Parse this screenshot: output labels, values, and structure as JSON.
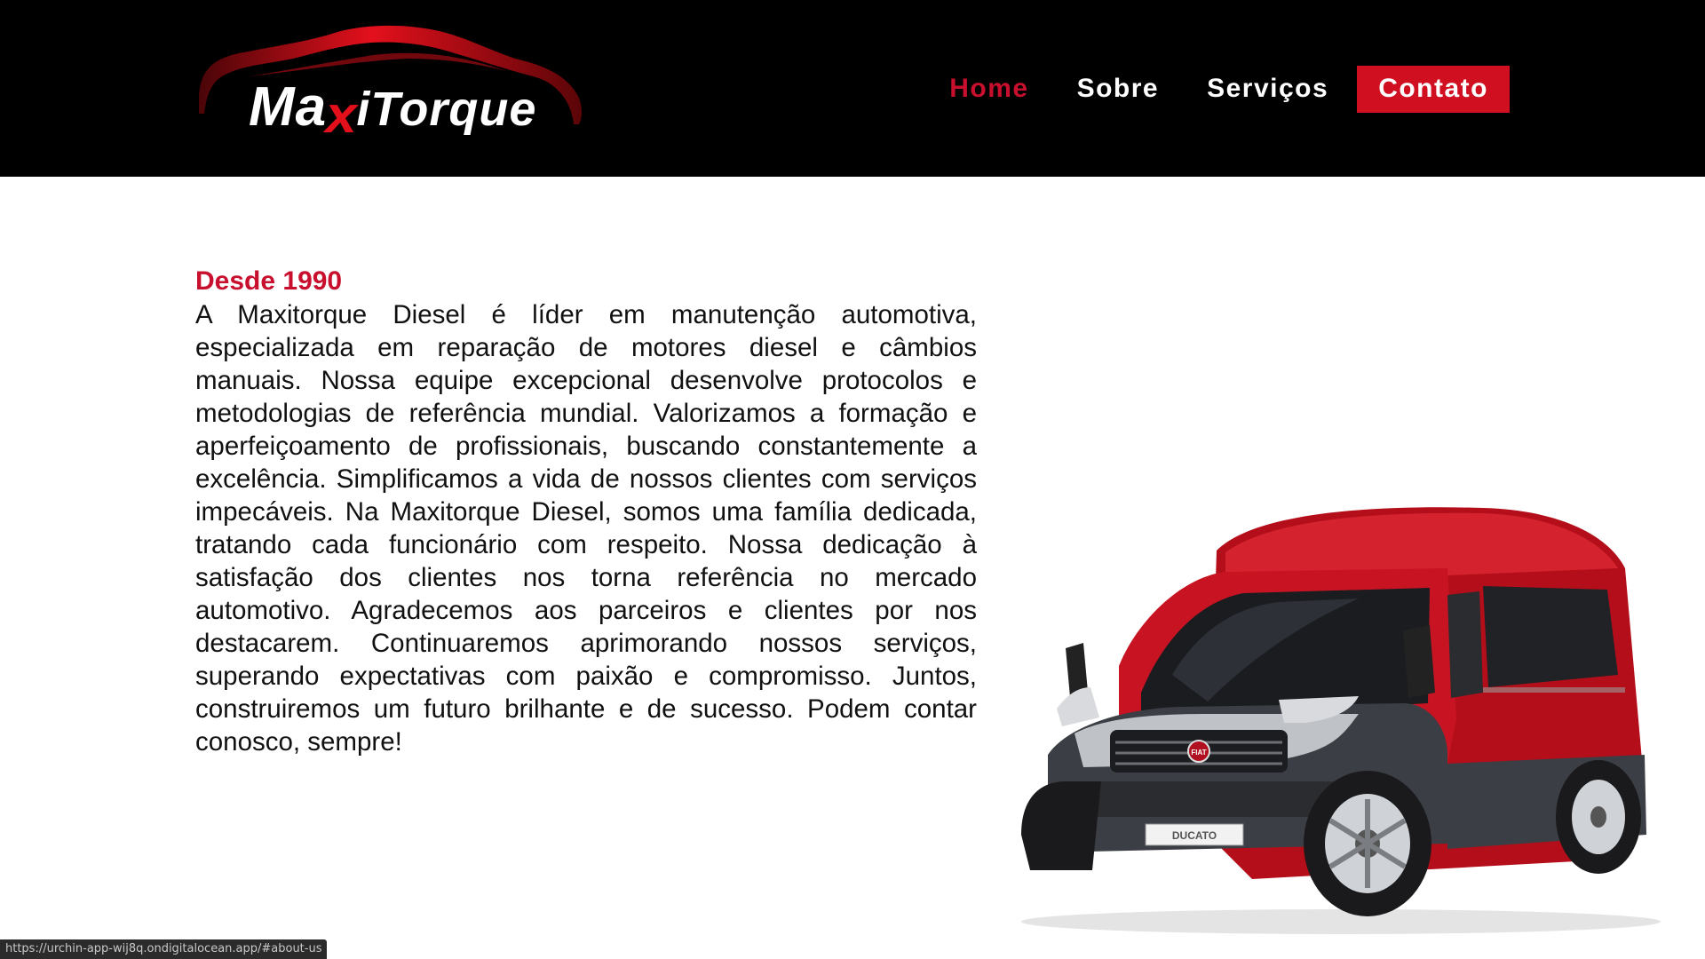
{
  "brand": {
    "logo_prefix": "Ma",
    "logo_x": "x",
    "logo_suffix": "iTorque",
    "colors": {
      "header_bg": "#000000",
      "accent": "#c8102e",
      "cta_bg": "#d01020",
      "van_red": "#c8101e"
    }
  },
  "nav": {
    "items": [
      {
        "label": "Home",
        "active": true
      },
      {
        "label": "Sobre",
        "active": false
      },
      {
        "label": "Serviços",
        "active": false
      },
      {
        "label": "Contato",
        "active": false,
        "cta": true
      }
    ]
  },
  "about": {
    "title": "Desde 1990",
    "text": "A Maxitorque Diesel é líder em manutenção automotiva, especializada em reparação de motores diesel e câmbios manuais. Nossa equipe excepcional desenvolve protocolos e metodologias de referência mundial. Valorizamos a formação e aperfeiçoamento de profissionais, buscando constantemente a excelência. Simplificamos a vida de nossos clientes com serviços impecáveis. Na Maxitorque Diesel, somos uma família dedicada, tratando cada funcionário com respeito. Nossa dedicação à satisfação dos clientes nos torna referência no mercado automotivo. Agradecemos aos parceiros e clientes por nos destacarem. Continuaremos aprimorando nossos serviços, superando expectativas com paixão e compromisso. Juntos, construiremos um futuro brilhante e de sucesso. Podem contar conosco, sempre!"
  },
  "hero_image": {
    "icon": "red-van-image",
    "badge": "FIAT",
    "plate": "DUCATO"
  },
  "status_bar": {
    "url": "https://urchin-app-wij8q.ondigitalocean.app/#about-us"
  }
}
